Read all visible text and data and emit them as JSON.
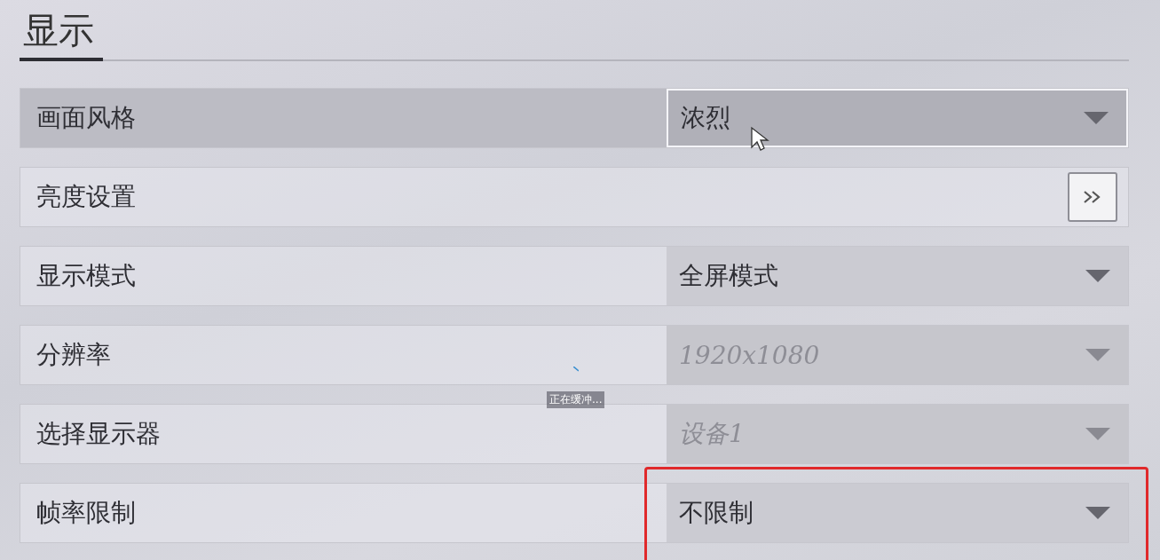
{
  "tabs": [
    {
      "label": "显示",
      "selected": true
    }
  ],
  "settings": [
    {
      "label": "画面风格",
      "kind": "dropdown",
      "value": "浓烈",
      "selected": true,
      "disabled": false,
      "highlighted": false
    },
    {
      "label": "亮度设置",
      "kind": "link",
      "selected": false
    },
    {
      "label": "显示模式",
      "kind": "dropdown",
      "value": "全屏模式",
      "selected": false,
      "disabled": false,
      "highlighted": false
    },
    {
      "label": "分辨率",
      "kind": "dropdown",
      "value": "1920x1080",
      "selected": false,
      "disabled": true,
      "highlighted": false
    },
    {
      "label": "选择显示器",
      "kind": "dropdown",
      "value": "设备1",
      "selected": false,
      "disabled": true,
      "highlighted": false
    },
    {
      "label": "帧率限制",
      "kind": "dropdown",
      "value": "不限制",
      "selected": false,
      "disabled": false,
      "highlighted": true
    }
  ],
  "buffering": {
    "text": "正在缓冲..."
  }
}
